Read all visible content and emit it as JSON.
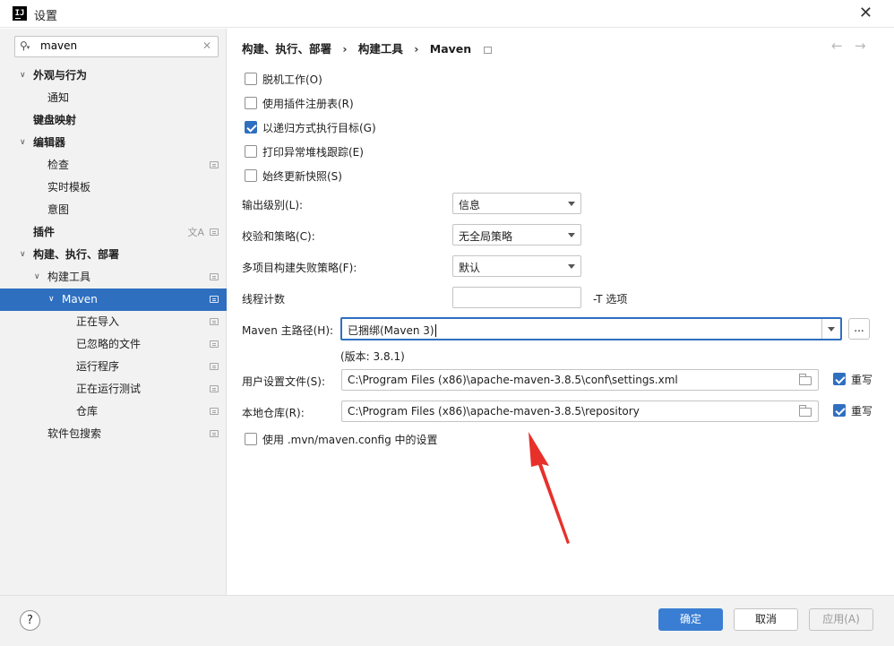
{
  "window": {
    "title": "设置",
    "icon_label": "IJ"
  },
  "search": {
    "value": "maven"
  },
  "tree": [
    {
      "label": "外观与行为",
      "level": 0,
      "expanded": true,
      "bold": true
    },
    {
      "label": "通知",
      "level": 1
    },
    {
      "label": "键盘映射",
      "level": 0,
      "bold": true
    },
    {
      "label": "编辑器",
      "level": 0,
      "expanded": true,
      "bold": true
    },
    {
      "label": "检查",
      "level": 1,
      "icon": true
    },
    {
      "label": "实时模板",
      "level": 1
    },
    {
      "label": "意图",
      "level": 1
    },
    {
      "label": "插件",
      "level": 0,
      "bold": true,
      "icon": true,
      "lang": true
    },
    {
      "label": "构建、执行、部署",
      "level": 0,
      "expanded": true,
      "bold": true
    },
    {
      "label": "构建工具",
      "level": 1,
      "expanded": true,
      "icon": true
    },
    {
      "label": "Maven",
      "level": 2,
      "expanded": true,
      "icon": true,
      "selected": true
    },
    {
      "label": "正在导入",
      "level": 3,
      "icon": true
    },
    {
      "label": "已忽略的文件",
      "level": 3,
      "icon": true
    },
    {
      "label": "运行程序",
      "level": 3,
      "icon": true
    },
    {
      "label": "正在运行测试",
      "level": 3,
      "icon": true
    },
    {
      "label": "仓库",
      "level": 3,
      "icon": true
    },
    {
      "label": "软件包搜索",
      "level": 1,
      "icon": true
    }
  ],
  "breadcrumb": {
    "part1": "构建、执行、部署",
    "part2": "构建工具",
    "part3": "Maven",
    "sep": "›"
  },
  "options": {
    "offline": {
      "label": "脱机工作(O)",
      "checked": false
    },
    "plugin_registry": {
      "label": "使用插件注册表(R)",
      "checked": false
    },
    "recursive": {
      "label": "以递归方式执行目标(G)",
      "checked": true
    },
    "print_stack": {
      "label": "打印异常堆栈跟踪(E)",
      "checked": false
    },
    "always_update": {
      "label": "始终更新快照(S)",
      "checked": false
    }
  },
  "fields": {
    "output_level": {
      "label": "输出级别(L):",
      "value": "信息"
    },
    "checksum": {
      "label": "校验和策略(C):",
      "value": "无全局策略"
    },
    "multiproject": {
      "label": "多项目构建失败策略(F):",
      "value": "默认"
    },
    "threads": {
      "label": "线程计数",
      "value": "",
      "note": "-T 选项"
    },
    "maven_home": {
      "label": "Maven 主路径(H):",
      "value": "已捆绑(Maven 3)",
      "version": "(版本: 3.8.1)",
      "browse": "..."
    },
    "user_settings": {
      "label": "用户设置文件(S):",
      "value": "C:\\Program Files (x86)\\apache-maven-3.8.5\\conf\\settings.xml",
      "override_label": "重写",
      "override": true
    },
    "local_repo": {
      "label": "本地仓库(R):",
      "value": "C:\\Program Files (x86)\\apache-maven-3.8.5\\repository",
      "override_label": "重写",
      "override": true
    },
    "mvn_config": {
      "label": "使用 .mvn/maven.config 中的设置",
      "checked": false
    }
  },
  "buttons": {
    "ok": "确定",
    "cancel": "取消",
    "apply": "应用(A)",
    "help": "?"
  },
  "colors": {
    "accent": "#2f6fc0",
    "annotation_arrow": "#e8302a"
  }
}
